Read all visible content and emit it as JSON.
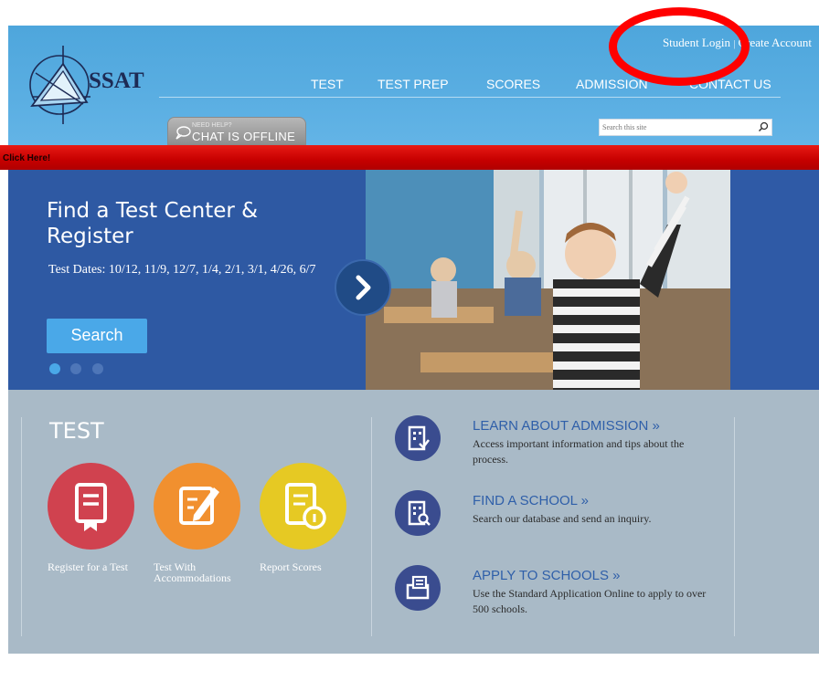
{
  "header": {
    "logo_text": "SSAT",
    "top_links": {
      "login": "Student Login",
      "separator": "|",
      "create": "Create Account"
    },
    "nav": [
      "TEST",
      "TEST PREP",
      "SCORES",
      "ADMISSION",
      "CONTACT US"
    ],
    "chat": {
      "small": "NEED HELP?",
      "big": "CHAT IS OFFLINE"
    },
    "search": {
      "placeholder": "Search this site",
      "icon": "search-icon"
    }
  },
  "banner": {
    "text": "Click Here!"
  },
  "hero": {
    "title": "Find a Test Center & Register",
    "dates": "Test Dates: 10/12, 11/9, 12/7, 1/4, 2/1, 3/1, 4/26, 6/7",
    "search_label": "Search",
    "next_icon": "chevron-right-icon"
  },
  "test": {
    "heading": "TEST",
    "items": [
      {
        "label": "Register for a Test",
        "color": "#d0424f",
        "icon": "certificate-icon"
      },
      {
        "label": "Test With Accommodations",
        "color": "#f1902f",
        "icon": "edit-document-icon"
      },
      {
        "label": "Report Scores",
        "color": "#e6c923",
        "icon": "report-info-icon"
      }
    ]
  },
  "resources": [
    {
      "title": "LEARN ABOUT ADMISSION »",
      "desc": "Access important information and tips about the process.",
      "icon": "building-check-icon"
    },
    {
      "title": "FIND A SCHOOL »",
      "desc": "Search our database and send an inquiry.",
      "icon": "building-search-icon"
    },
    {
      "title": "APPLY TO SCHOOLS »",
      "desc": "Use the Standard Application Online to apply to over 500 schools.",
      "icon": "folder-document-icon"
    }
  ],
  "colors": {
    "header": "#58aee2",
    "hero": "#2e59a3",
    "banner": "#d80a08",
    "bottom": "#a9bac7",
    "annotation": "#ff0000"
  }
}
